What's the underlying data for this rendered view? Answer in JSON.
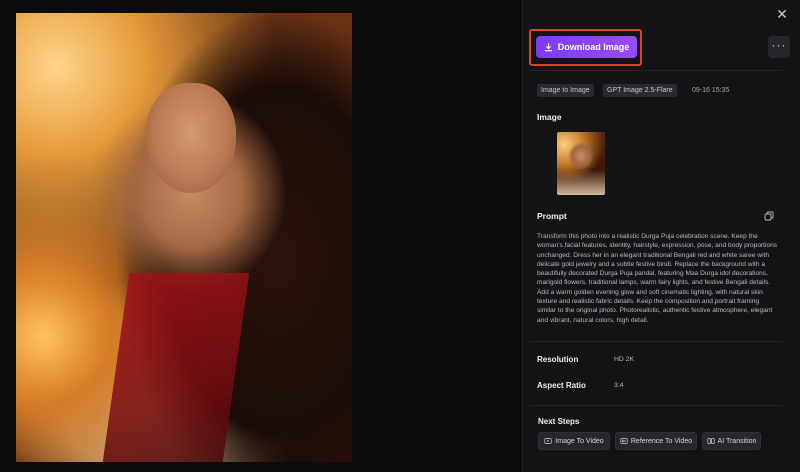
{
  "toolbar": {
    "download_label": "Download Image",
    "more_label": "···",
    "close_label": "✕"
  },
  "tags": [
    "Image to Image",
    "GPT Image 2.5-Flare"
  ],
  "timestamp": "09-16 15:35",
  "sections": {
    "image_title": "Image",
    "prompt_title": "Prompt",
    "prompt_text": "Transform this photo into a realistic Durga Puja celebration scene. Keep the woman's facial features, identity, hairstyle, expression, pose, and body proportions unchanged. Dress her in an elegant traditional Bengali red and white saree with delicate gold jewelry and a subtle festive bindi. Replace the background with a beautifully decorated Durga Puja pandal, featuring Maa Durga idol decorations, marigold flowers, traditional lamps, warm fairy lights, and festive Bengali details. Add a warm golden evening glow and soft cinematic lighting, with natural skin texture and realistic fabric details. Keep the composition and portrait framing similar to the original photo. Photorealistic, authentic festive atmosphere, elegant and vibrant, natural colors, high detail."
  },
  "meta": {
    "resolution_label": "Resolution",
    "resolution_value": "HD 2K",
    "aspect_label": "Aspect Ratio",
    "aspect_value": "3:4"
  },
  "next_steps": {
    "title": "Next Steps",
    "buttons": [
      "Image To Video",
      "Reference To Video",
      "AI Transition"
    ]
  },
  "colors": {
    "accent": "#8b45f6",
    "highlight_border": "#d8442c",
    "panel_bg": "#141416"
  }
}
